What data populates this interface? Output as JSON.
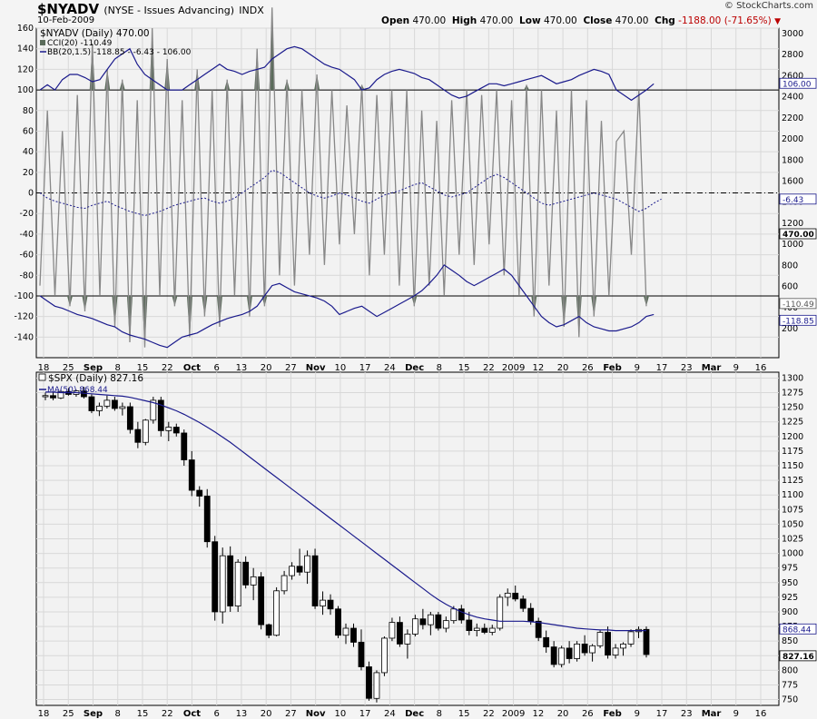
{
  "header": {
    "symbol": "$NYADV",
    "description": "(NYSE - Issues Advancing)",
    "exchange": "INDX",
    "date": "10-Feb-2009",
    "brand": "© StockCharts.com",
    "open_label": "Open",
    "open": "470.00",
    "high_label": "High",
    "high": "470.00",
    "low_label": "Low",
    "low": "470.00",
    "close_label": "Close",
    "close": "470.00",
    "chg_label": "Chg",
    "chg": "-1188.00 (-71.65%)"
  },
  "x_axis_labels": [
    "18",
    "25",
    "Sep",
    "8",
    "15",
    "22",
    "Oct",
    "6",
    "13",
    "20",
    "27",
    "Nov",
    "10",
    "17",
    "24",
    "Dec",
    "8",
    "15",
    "22",
    "2009",
    "12",
    "20",
    "26",
    "Feb",
    "9",
    "17",
    "23",
    "Mar",
    "9",
    "16"
  ],
  "chart_data": [
    {
      "type": "line",
      "title": "$NYADV (Daily) 470.00",
      "legend": [
        "CCI(20) -110.49",
        "BB(20,1.5) -118.85 - -6.43 - 106.00"
      ],
      "y_left_ticks": [
        160,
        140,
        120,
        100,
        80,
        60,
        40,
        20,
        0,
        -20,
        -40,
        -60,
        -80,
        -100,
        -120,
        -140
      ],
      "y_right_ticks": [
        3000,
        2800,
        2600,
        2400,
        2200,
        2000,
        1800,
        1600,
        1400,
        1200,
        1000,
        800,
        600,
        400,
        200
      ],
      "ylim": [
        -160,
        160
      ],
      "reference_lines": [
        100,
        0,
        -100
      ],
      "right_value_labels": [
        "106.00",
        "-6.43",
        "470.00",
        "-110.49",
        "-118.85"
      ],
      "series": [
        {
          "name": "CCI(20)",
          "values": [
            -90,
            80,
            -100,
            60,
            -110,
            95,
            -115,
            145,
            -100,
            120,
            -130,
            110,
            -145,
            90,
            -150,
            160,
            -100,
            130,
            -110,
            90,
            -140,
            120,
            -120,
            100,
            -130,
            110,
            -100,
            100,
            -120,
            140,
            -110,
            180,
            -80,
            110,
            -90,
            100,
            -60,
            115,
            -70,
            100,
            -50,
            85,
            -40,
            105,
            -80,
            95,
            -60,
            100,
            -90,
            100,
            -110,
            80,
            -90,
            70,
            -100,
            90,
            -60,
            100,
            -70,
            95,
            -50,
            100,
            -80,
            90,
            -100,
            105,
            -120,
            100,
            -90,
            80,
            -130,
            100,
            -140,
            90,
            -120,
            70,
            -100,
            50,
            60,
            -60,
            100,
            -110
          ]
        },
        {
          "name": "BB upper",
          "values": [
            100,
            105,
            100,
            110,
            115,
            115,
            112,
            108,
            110,
            120,
            130,
            135,
            140,
            125,
            115,
            110,
            105,
            100,
            100,
            100,
            105,
            110,
            115,
            120,
            125,
            120,
            118,
            115,
            118,
            120,
            122,
            130,
            135,
            140,
            142,
            140,
            135,
            130,
            125,
            122,
            120,
            115,
            110,
            100,
            102,
            110,
            115,
            118,
            120,
            118,
            116,
            112,
            110,
            105,
            100,
            95,
            92,
            94,
            98,
            102,
            106,
            106,
            104,
            106,
            108,
            110,
            112,
            114,
            110,
            106,
            108,
            110,
            114,
            117,
            120,
            118,
            115,
            100,
            95,
            90,
            95,
            100,
            106
          ]
        },
        {
          "name": "BB middle",
          "values": [
            0,
            -5,
            -8,
            -10,
            -12,
            -14,
            -15,
            -12,
            -10,
            -8,
            -12,
            -15,
            -18,
            -20,
            -22,
            -20,
            -18,
            -15,
            -12,
            -10,
            -8,
            -6,
            -5,
            -8,
            -10,
            -8,
            -5,
            0,
            5,
            10,
            15,
            22,
            20,
            15,
            10,
            5,
            0,
            -3,
            -5,
            -3,
            0,
            -2,
            -5,
            -8,
            -10,
            -6,
            -2,
            0,
            2,
            5,
            8,
            10,
            6,
            2,
            -2,
            -4,
            -2,
            0,
            5,
            10,
            15,
            18,
            15,
            10,
            5,
            0,
            -5,
            -10,
            -12,
            -10,
            -8,
            -6,
            -4,
            -2,
            0,
            -2,
            -4,
            -6,
            -10,
            -14,
            -18,
            -15,
            -10,
            -6
          ]
        },
        {
          "name": "BB lower",
          "values": [
            -100,
            -105,
            -110,
            -112,
            -115,
            -118,
            -120,
            -122,
            -125,
            -128,
            -130,
            -135,
            -138,
            -140,
            -142,
            -145,
            -148,
            -150,
            -145,
            -140,
            -138,
            -136,
            -132,
            -128,
            -125,
            -122,
            -120,
            -118,
            -115,
            -110,
            -100,
            -90,
            -88,
            -92,
            -96,
            -98,
            -100,
            -102,
            -105,
            -110,
            -118,
            -115,
            -112,
            -110,
            -115,
            -120,
            -116,
            -112,
            -108,
            -104,
            -100,
            -95,
            -88,
            -80,
            -70,
            -75,
            -80,
            -86,
            -90,
            -86,
            -82,
            -78,
            -74,
            -80,
            -90,
            -100,
            -110,
            -120,
            -126,
            -130,
            -128,
            -124,
            -120,
            -126,
            -130,
            -132,
            -134,
            -134,
            -132,
            -130,
            -126,
            -120,
            -118
          ]
        }
      ]
    },
    {
      "type": "bar",
      "subtype": "candlestick",
      "title": "$SPX (Daily) 827.16",
      "legend": [
        "MA(50) 868.44"
      ],
      "y_right_ticks": [
        1300,
        1275,
        1250,
        1225,
        1200,
        1175,
        1150,
        1125,
        1100,
        1075,
        1050,
        1025,
        1000,
        975,
        950,
        925,
        900,
        875,
        850,
        825,
        800,
        775,
        750
      ],
      "ylim": [
        740,
        1310
      ],
      "right_value_labels": [
        "868.44",
        "827.16"
      ],
      "candles": [
        {
          "o": 1268,
          "h": 1275,
          "l": 1262,
          "c": 1270
        },
        {
          "o": 1270,
          "h": 1276,
          "l": 1262,
          "c": 1266
        },
        {
          "o": 1266,
          "h": 1280,
          "l": 1264,
          "c": 1277
        },
        {
          "o": 1277,
          "h": 1283,
          "l": 1270,
          "c": 1272
        },
        {
          "o": 1272,
          "h": 1280,
          "l": 1268,
          "c": 1278
        },
        {
          "o": 1278,
          "h": 1285,
          "l": 1265,
          "c": 1268
        },
        {
          "o": 1268,
          "h": 1272,
          "l": 1240,
          "c": 1244
        },
        {
          "o": 1244,
          "h": 1258,
          "l": 1235,
          "c": 1252
        },
        {
          "o": 1252,
          "h": 1270,
          "l": 1248,
          "c": 1262
        },
        {
          "o": 1262,
          "h": 1268,
          "l": 1244,
          "c": 1248
        },
        {
          "o": 1248,
          "h": 1258,
          "l": 1236,
          "c": 1251
        },
        {
          "o": 1251,
          "h": 1258,
          "l": 1205,
          "c": 1212
        },
        {
          "o": 1212,
          "h": 1225,
          "l": 1180,
          "c": 1190
        },
        {
          "o": 1190,
          "h": 1230,
          "l": 1185,
          "c": 1228
        },
        {
          "o": 1228,
          "h": 1268,
          "l": 1222,
          "c": 1262
        },
        {
          "o": 1262,
          "h": 1268,
          "l": 1200,
          "c": 1210
        },
        {
          "o": 1210,
          "h": 1225,
          "l": 1192,
          "c": 1216
        },
        {
          "o": 1216,
          "h": 1222,
          "l": 1200,
          "c": 1206
        },
        {
          "o": 1206,
          "h": 1212,
          "l": 1150,
          "c": 1160
        },
        {
          "o": 1160,
          "h": 1175,
          "l": 1098,
          "c": 1108
        },
        {
          "o": 1108,
          "h": 1115,
          "l": 1080,
          "c": 1098
        },
        {
          "o": 1098,
          "h": 1110,
          "l": 1010,
          "c": 1020
        },
        {
          "o": 1020,
          "h": 1030,
          "l": 885,
          "c": 900
        },
        {
          "o": 900,
          "h": 1010,
          "l": 880,
          "c": 996
        },
        {
          "o": 996,
          "h": 1012,
          "l": 900,
          "c": 910
        },
        {
          "o": 910,
          "h": 990,
          "l": 900,
          "c": 985
        },
        {
          "o": 985,
          "h": 995,
          "l": 940,
          "c": 946
        },
        {
          "o": 946,
          "h": 975,
          "l": 920,
          "c": 960
        },
        {
          "o": 960,
          "h": 968,
          "l": 870,
          "c": 878
        },
        {
          "o": 878,
          "h": 880,
          "l": 855,
          "c": 860
        },
        {
          "o": 860,
          "h": 942,
          "l": 858,
          "c": 936
        },
        {
          "o": 936,
          "h": 970,
          "l": 930,
          "c": 962
        },
        {
          "o": 962,
          "h": 985,
          "l": 955,
          "c": 978
        },
        {
          "o": 978,
          "h": 1008,
          "l": 962,
          "c": 968
        },
        {
          "o": 968,
          "h": 1005,
          "l": 948,
          "c": 996
        },
        {
          "o": 996,
          "h": 1008,
          "l": 905,
          "c": 910
        },
        {
          "o": 910,
          "h": 935,
          "l": 895,
          "c": 920
        },
        {
          "o": 920,
          "h": 930,
          "l": 895,
          "c": 905
        },
        {
          "o": 905,
          "h": 910,
          "l": 855,
          "c": 860
        },
        {
          "o": 860,
          "h": 880,
          "l": 845,
          "c": 872
        },
        {
          "o": 872,
          "h": 880,
          "l": 840,
          "c": 848
        },
        {
          "o": 848,
          "h": 870,
          "l": 800,
          "c": 806
        },
        {
          "o": 806,
          "h": 815,
          "l": 748,
          "c": 752
        },
        {
          "o": 752,
          "h": 800,
          "l": 745,
          "c": 796
        },
        {
          "o": 796,
          "h": 858,
          "l": 790,
          "c": 855
        },
        {
          "o": 855,
          "h": 890,
          "l": 850,
          "c": 882
        },
        {
          "o": 882,
          "h": 892,
          "l": 840,
          "c": 845
        },
        {
          "o": 845,
          "h": 870,
          "l": 820,
          "c": 862
        },
        {
          "o": 862,
          "h": 895,
          "l": 858,
          "c": 888
        },
        {
          "o": 888,
          "h": 905,
          "l": 870,
          "c": 878
        },
        {
          "o": 878,
          "h": 900,
          "l": 860,
          "c": 895
        },
        {
          "o": 895,
          "h": 900,
          "l": 868,
          "c": 872
        },
        {
          "o": 872,
          "h": 892,
          "l": 865,
          "c": 885
        },
        {
          "o": 885,
          "h": 910,
          "l": 880,
          "c": 905
        },
        {
          "o": 905,
          "h": 912,
          "l": 880,
          "c": 886
        },
        {
          "o": 886,
          "h": 900,
          "l": 860,
          "c": 868
        },
        {
          "o": 868,
          "h": 880,
          "l": 858,
          "c": 872
        },
        {
          "o": 872,
          "h": 880,
          "l": 862,
          "c": 865
        },
        {
          "o": 865,
          "h": 878,
          "l": 860,
          "c": 872
        },
        {
          "o": 872,
          "h": 930,
          "l": 868,
          "c": 925
        },
        {
          "o": 925,
          "h": 940,
          "l": 910,
          "c": 932
        },
        {
          "o": 932,
          "h": 945,
          "l": 918,
          "c": 922
        },
        {
          "o": 922,
          "h": 928,
          "l": 900,
          "c": 906
        },
        {
          "o": 906,
          "h": 915,
          "l": 878,
          "c": 884
        },
        {
          "o": 884,
          "h": 890,
          "l": 850,
          "c": 856
        },
        {
          "o": 856,
          "h": 868,
          "l": 830,
          "c": 840
        },
        {
          "o": 840,
          "h": 850,
          "l": 805,
          "c": 810
        },
        {
          "o": 810,
          "h": 842,
          "l": 805,
          "c": 838
        },
        {
          "o": 838,
          "h": 850,
          "l": 812,
          "c": 820
        },
        {
          "o": 820,
          "h": 850,
          "l": 815,
          "c": 845
        },
        {
          "o": 845,
          "h": 860,
          "l": 825,
          "c": 830
        },
        {
          "o": 830,
          "h": 845,
          "l": 815,
          "c": 842
        },
        {
          "o": 842,
          "h": 868,
          "l": 838,
          "c": 865
        },
        {
          "o": 865,
          "h": 875,
          "l": 820,
          "c": 826
        },
        {
          "o": 826,
          "h": 845,
          "l": 820,
          "c": 838
        },
        {
          "o": 838,
          "h": 848,
          "l": 825,
          "c": 845
        },
        {
          "o": 845,
          "h": 870,
          "l": 840,
          "c": 866
        },
        {
          "o": 866,
          "h": 875,
          "l": 855,
          "c": 870
        },
        {
          "o": 870,
          "h": 875,
          "l": 822,
          "c": 827
        }
      ],
      "ma50": [
        1276,
        1276,
        1275,
        1275,
        1275,
        1274,
        1273,
        1272,
        1271,
        1270,
        1269,
        1267,
        1264,
        1261,
        1258,
        1254,
        1249,
        1244,
        1238,
        1231,
        1224,
        1216,
        1208,
        1199,
        1190,
        1180,
        1170,
        1160,
        1150,
        1140,
        1130,
        1120,
        1110,
        1100,
        1090,
        1080,
        1070,
        1060,
        1050,
        1040,
        1030,
        1020,
        1010,
        1000,
        990,
        980,
        970,
        960,
        950,
        940,
        930,
        921,
        913,
        906,
        900,
        895,
        891,
        888,
        886,
        884,
        884,
        884,
        884,
        883,
        882,
        880,
        878,
        876,
        874,
        872,
        871,
        870,
        869,
        869,
        868,
        868,
        868,
        868,
        868
      ]
    }
  ]
}
